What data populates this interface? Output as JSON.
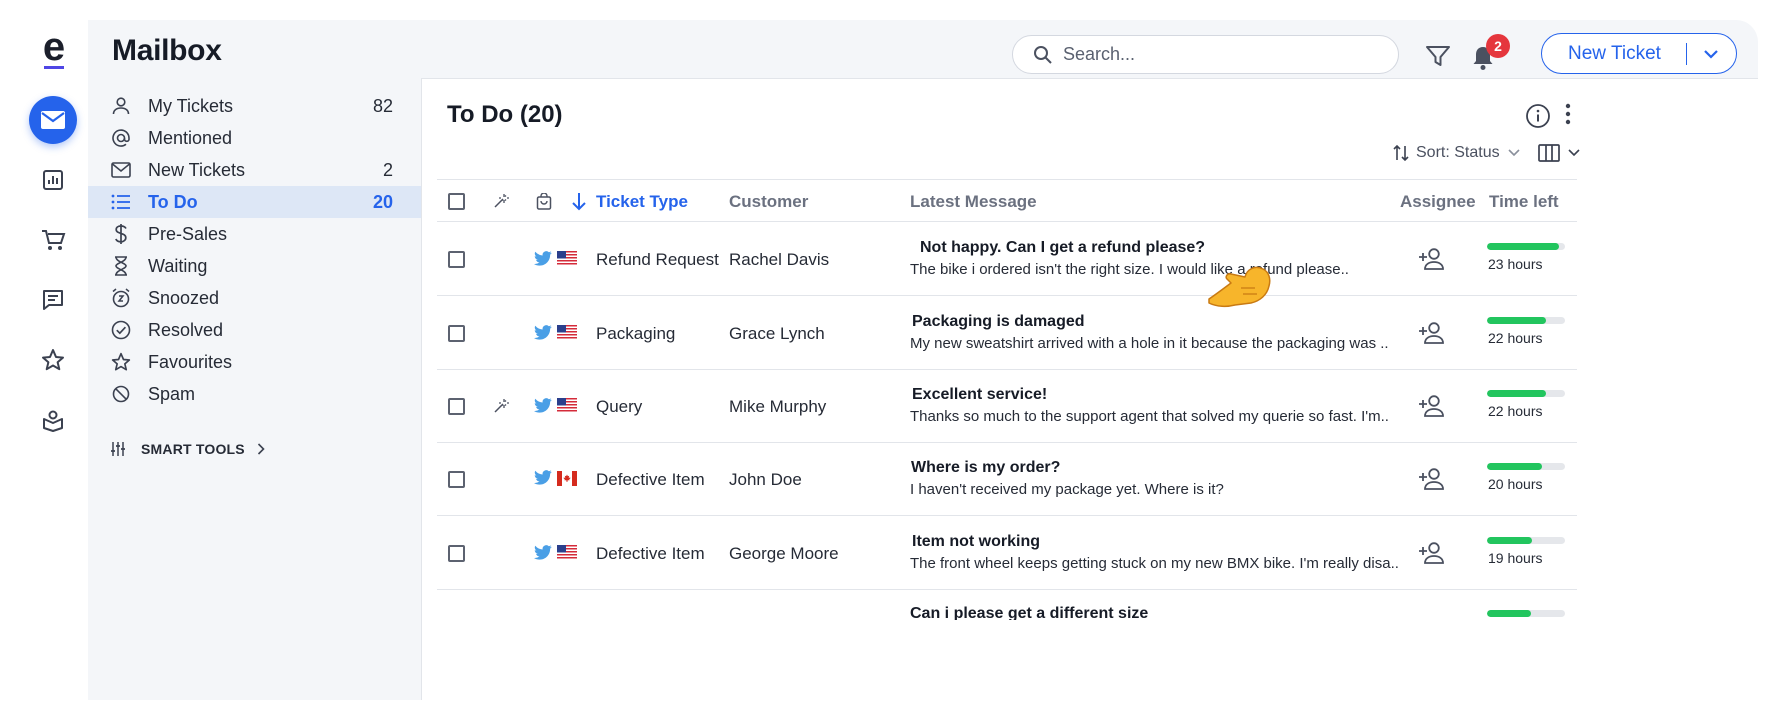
{
  "app": {
    "title": "Mailbox",
    "logo_letter": "e",
    "brand_color": "#2563eb",
    "rail_icons": [
      "mail-icon",
      "reports-icon",
      "cart-icon",
      "chat-icon",
      "star-icon",
      "knowledge-base-icon"
    ]
  },
  "header": {
    "search_placeholder": "Search...",
    "notification_count": "2",
    "new_ticket_label": "New Ticket"
  },
  "sidebar": {
    "items": [
      {
        "label": "My Tickets",
        "count": "82",
        "icon": "person-icon"
      },
      {
        "label": "Mentioned",
        "count": "",
        "icon": "at-icon"
      },
      {
        "label": "New Tickets",
        "count": "2",
        "icon": "envelope-icon"
      },
      {
        "label": "To Do",
        "count": "20",
        "icon": "list-icon",
        "active": true
      },
      {
        "label": "Pre-Sales",
        "count": "",
        "icon": "dollar-icon"
      },
      {
        "label": "Waiting",
        "count": "",
        "icon": "hourglass-icon"
      },
      {
        "label": "Snoozed",
        "count": "",
        "icon": "alarm-icon"
      },
      {
        "label": "Resolved",
        "count": "",
        "icon": "check-circle-icon"
      },
      {
        "label": "Favourites",
        "count": "",
        "icon": "star-icon"
      },
      {
        "label": "Spam",
        "count": "",
        "icon": "block-icon"
      }
    ],
    "smart_tools_label": "SMART TOOLS"
  },
  "main": {
    "title": "To Do (20)",
    "sort_label": "Sort: Status",
    "columns": {
      "ticket_type": "Ticket Type",
      "customer": "Customer",
      "latest_message": "Latest Message",
      "assignee": "Assignee",
      "time_left": "Time left"
    },
    "rows": [
      {
        "magic": false,
        "flag": "US",
        "type": "Refund Request",
        "customer": "Rachel Davis",
        "msg_title": "Not happy. Can I get a refund please?",
        "msg_body": "The bike i ordered isn't the right size. I would like a refund please..",
        "progress": 0.92,
        "time_left": "23 hours"
      },
      {
        "magic": false,
        "flag": "US",
        "type": "Packaging",
        "customer": "Grace Lynch",
        "msg_title": "Packaging is damaged",
        "msg_body": "My new sweatshirt arrived with a hole in it because the packaging was ..",
        "progress": 0.75,
        "time_left": "22 hours"
      },
      {
        "magic": true,
        "flag": "US",
        "type": "Query",
        "customer": "Mike Murphy",
        "msg_title": "Excellent service!",
        "msg_body": "Thanks so much to the support agent that solved my querie so fast. I'm..",
        "progress": 0.75,
        "time_left": "22 hours"
      },
      {
        "magic": false,
        "flag": "CA",
        "type": "Defective Item",
        "customer": "John Doe",
        "msg_title": "Where is my order?",
        "msg_body": "I haven't received my package yet. Where is it?",
        "progress": 0.71,
        "time_left": "20 hours"
      },
      {
        "magic": false,
        "flag": "US",
        "type": "Defective Item",
        "customer": "George Moore",
        "msg_title": "Item not working",
        "msg_body": "The front wheel keeps getting stuck on my new BMX bike. I'm really disa..",
        "progress": 0.58,
        "time_left": "19 hours"
      },
      {
        "magic": false,
        "flag": "",
        "type": "",
        "customer": "",
        "msg_title": "Can i please get a different size",
        "msg_body": "",
        "progress": 0.57,
        "time_left": ""
      }
    ]
  },
  "colors": {
    "accent": "#2563eb",
    "progress": "#22c55e",
    "badge": "#e5363d",
    "active_nav_bg": "#dde7f6"
  }
}
